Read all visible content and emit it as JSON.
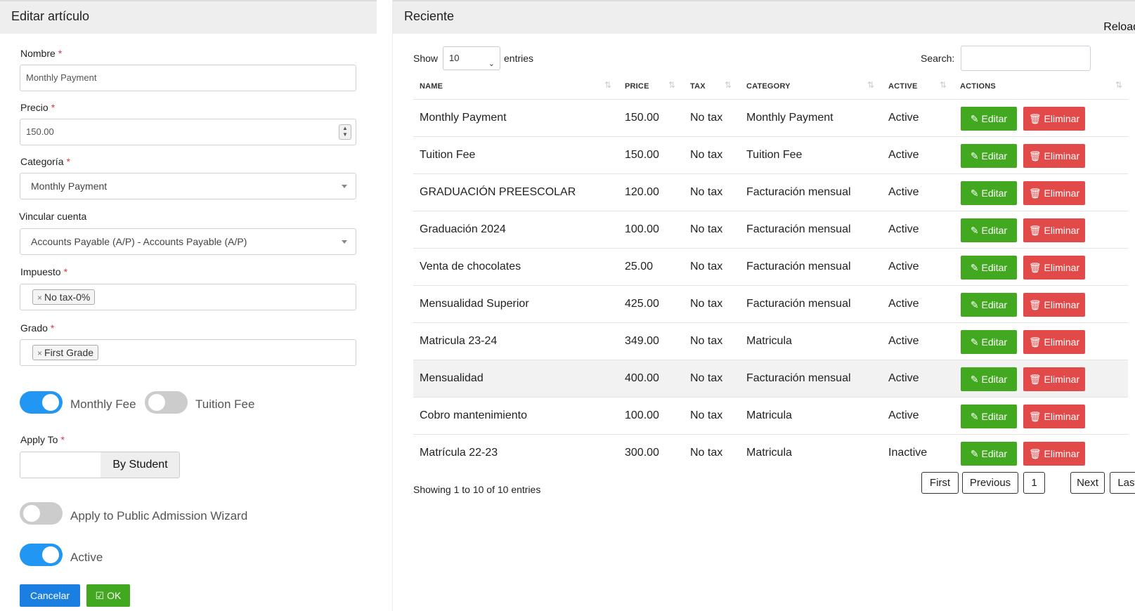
{
  "form": {
    "title": "Editar artículo",
    "nombre_label": "Nombre",
    "nombre_value": "Monthly Payment",
    "precio_label": "Precio",
    "precio_value": "150.00",
    "categoria_label": "Categoría",
    "categoria_value": "Monthly Payment",
    "vincular_label": "Vincular cuenta",
    "vincular_value": "Accounts Payable (A/P) - Accounts Payable (A/P)",
    "impuesto_label": "Impuesto",
    "impuesto_tag": "No tax-0%",
    "grado_label": "Grado",
    "grado_tag": "First Grade",
    "tag_remove": "×",
    "required_mark": "*",
    "monthly_fee_label": "Monthly Fee",
    "monthly_fee_on": true,
    "tuition_fee_label": "Tuition Fee",
    "tuition_fee_on": false,
    "apply_to_label": "Apply To",
    "apply_to_value": "By Student",
    "public_wizard_label": "Apply to Public Admission Wizard",
    "public_wizard_on": false,
    "active_label": "Active",
    "active_on": true,
    "cancel_label": "Cancelar",
    "ok_label": "OK"
  },
  "recent": {
    "title": "Reciente",
    "reload_label": "Reload",
    "show_label": "Show",
    "entries_label": "entries",
    "page_length": "10",
    "search_label": "Search:",
    "search_value": "",
    "columns": [
      "NAME",
      "PRICE",
      "TAX",
      "CATEGORY",
      "ACTIVE",
      "ACTIONS"
    ],
    "edit_label": "Editar",
    "delete_label": "Eliminar",
    "rows": [
      {
        "name": "Monthly Payment",
        "price": "150.00",
        "tax": "No tax",
        "category": "Monthly Payment",
        "active": "Active"
      },
      {
        "name": "Tuition Fee",
        "price": "150.00",
        "tax": "No tax",
        "category": "Tuition Fee",
        "active": "Active"
      },
      {
        "name": "GRADUACIÓN PREESCOLAR",
        "price": "120.00",
        "tax": "No tax",
        "category": "Facturación mensual",
        "active": "Active"
      },
      {
        "name": "Graduación 2024",
        "price": "100.00",
        "tax": "No tax",
        "category": "Facturación mensual",
        "active": "Active"
      },
      {
        "name": "Venta de chocolates",
        "price": "25.00",
        "tax": "No tax",
        "category": "Facturación mensual",
        "active": "Active"
      },
      {
        "name": "Mensualidad Superior",
        "price": "425.00",
        "tax": "No tax",
        "category": "Facturación mensual",
        "active": "Active"
      },
      {
        "name": "Matricula 23-24",
        "price": "349.00",
        "tax": "No tax",
        "category": "Matricula",
        "active": "Active"
      },
      {
        "name": "Mensualidad",
        "price": "400.00",
        "tax": "No tax",
        "category": "Facturación mensual",
        "active": "Active"
      },
      {
        "name": "Cobro mantenimiento",
        "price": "100.00",
        "tax": "No tax",
        "category": "Matricula",
        "active": "Active"
      },
      {
        "name": "Matrícula 22-23",
        "price": "300.00",
        "tax": "No tax",
        "category": "Matricula",
        "active": "Inactive"
      }
    ],
    "highlighted_row": 7,
    "info": "Showing 1 to 10 of 10 entries",
    "pagination": {
      "first": "First",
      "previous": "Previous",
      "current": "1",
      "next": "Next",
      "last": "Last"
    }
  },
  "colors": {
    "accent": "#2196f3",
    "success": "#41a820",
    "danger": "#e24a4a",
    "primary": "#1a7fe0"
  }
}
